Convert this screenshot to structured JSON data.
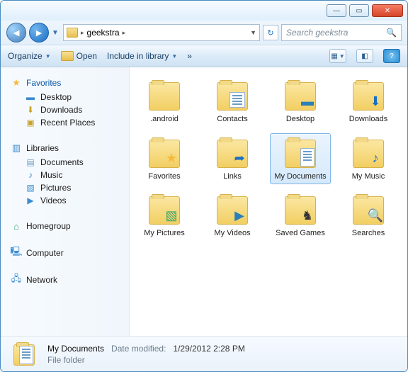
{
  "address": {
    "crumb1": "geekstra"
  },
  "search": {
    "placeholder": "Search geekstra"
  },
  "toolbar": {
    "organize": "Organize",
    "open": "Open",
    "include": "Include in library",
    "more": "»"
  },
  "sidebar": {
    "favorites": "Favorites",
    "fav_items": [
      "Desktop",
      "Downloads",
      "Recent Places"
    ],
    "libraries": "Libraries",
    "lib_items": [
      "Documents",
      "Music",
      "Pictures",
      "Videos"
    ],
    "homegroup": "Homegroup",
    "computer": "Computer",
    "network": "Network"
  },
  "folders": [
    {
      "label": ".android",
      "overlay": ""
    },
    {
      "label": "Contacts",
      "overlay": "card"
    },
    {
      "label": "Desktop",
      "overlay": "desk"
    },
    {
      "label": "Downloads",
      "overlay": "down"
    },
    {
      "label": "Favorites",
      "overlay": "star"
    },
    {
      "label": "Links",
      "overlay": "link"
    },
    {
      "label": "My Documents",
      "overlay": "doc",
      "selected": true
    },
    {
      "label": "My Music",
      "overlay": "music"
    },
    {
      "label": "My Pictures",
      "overlay": "pic"
    },
    {
      "label": "My Videos",
      "overlay": "vid"
    },
    {
      "label": "Saved Games",
      "overlay": "game"
    },
    {
      "label": "Searches",
      "overlay": "search"
    }
  ],
  "status": {
    "name": "My Documents",
    "mod_label": "Date modified:",
    "mod_value": "1/29/2012 2:28 PM",
    "type": "File folder"
  }
}
